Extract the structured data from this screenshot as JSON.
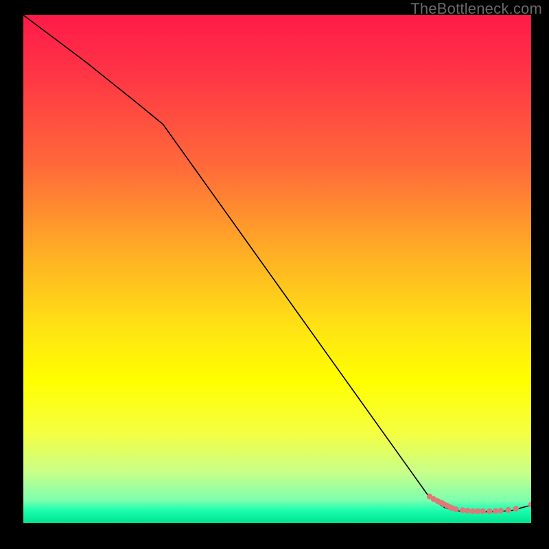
{
  "watermark": "TheBottleneck.com",
  "chart_data": {
    "type": "line",
    "title": "",
    "xlabel": "",
    "ylabel": "",
    "xlim": [
      0,
      100
    ],
    "ylim": [
      0,
      100
    ],
    "background_gradient": {
      "stops": [
        {
          "offset": 0.0,
          "color": "#ff1a49"
        },
        {
          "offset": 0.12,
          "color": "#ff3645"
        },
        {
          "offset": 0.3,
          "color": "#ff6b3a"
        },
        {
          "offset": 0.48,
          "color": "#ffb324"
        },
        {
          "offset": 0.62,
          "color": "#ffe413"
        },
        {
          "offset": 0.72,
          "color": "#ffff00"
        },
        {
          "offset": 0.82,
          "color": "#f6ff3f"
        },
        {
          "offset": 0.9,
          "color": "#c9ff89"
        },
        {
          "offset": 0.955,
          "color": "#7effae"
        },
        {
          "offset": 0.975,
          "color": "#1bffb0"
        },
        {
          "offset": 1.0,
          "color": "#00e38f"
        }
      ]
    },
    "series": [
      {
        "name": "main-curve",
        "color": "#000000",
        "width": 1.6,
        "x": [
          0.0,
          12.0,
          22.0,
          27.5,
          35.0,
          45.0,
          55.0,
          65.0,
          75.0,
          80.0,
          83.0,
          85.0,
          88.0,
          92.0,
          96.0,
          100.0
        ],
        "y": [
          100.0,
          91.0,
          83.0,
          78.5,
          68.0,
          54.0,
          40.0,
          26.0,
          12.0,
          5.0,
          3.0,
          2.4,
          2.2,
          2.2,
          2.4,
          3.5
        ]
      }
    ],
    "scatter": {
      "name": "bottom-points",
      "color": "#e07878",
      "radius": 4.2,
      "x": [
        80.0,
        80.8,
        81.6,
        82.3,
        82.8,
        83.4,
        84.0,
        84.5,
        85.2,
        86.5,
        87.5,
        88.5,
        89.5,
        90.5,
        91.8,
        93.0,
        94.0,
        95.5,
        97.0,
        100.0
      ],
      "y": [
        5.2,
        4.7,
        4.3,
        4.0,
        3.7,
        3.4,
        3.1,
        2.9,
        2.7,
        2.5,
        2.4,
        2.3,
        2.3,
        2.3,
        2.3,
        2.35,
        2.4,
        2.55,
        2.8,
        3.6
      ]
    }
  }
}
